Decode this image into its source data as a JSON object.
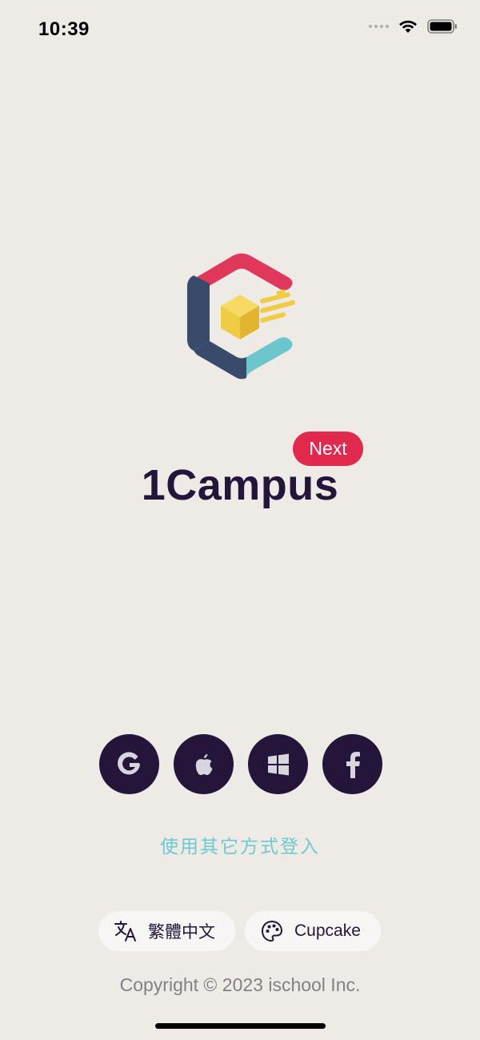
{
  "status_bar": {
    "time": "10:39"
  },
  "app": {
    "name": "1Campus",
    "badge": "Next"
  },
  "login": {
    "providers": [
      {
        "name": "Google",
        "icon": "google-icon"
      },
      {
        "name": "Apple",
        "icon": "apple-icon"
      },
      {
        "name": "Microsoft",
        "icon": "windows-icon"
      },
      {
        "name": "Facebook",
        "icon": "facebook-icon"
      }
    ],
    "other_methods_label": "使用其它方式登入"
  },
  "footer": {
    "language_label": "繁體中文",
    "theme_label": "Cupcake",
    "copyright": "Copyright © 2023 ischool Inc."
  },
  "colors": {
    "background": "#EEEAE6",
    "primary_dark": "#24163A",
    "badge_red": "#E0294C",
    "link_teal": "#6FC9CC",
    "logo_red": "#E0385A",
    "logo_navy": "#3A4A6B",
    "logo_teal": "#6CC7CD",
    "logo_yellow": "#F0CC45"
  }
}
